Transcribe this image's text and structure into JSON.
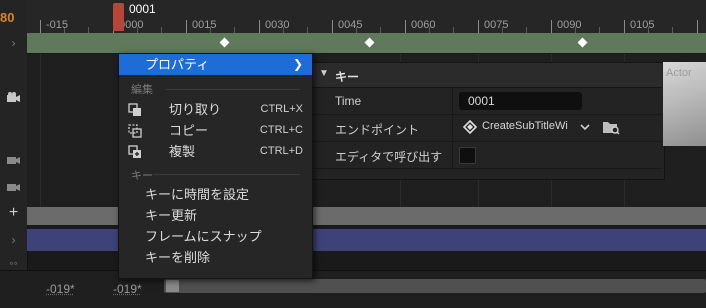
{
  "current_frame": "80",
  "playhead": {
    "label": "0001"
  },
  "ruler": {
    "labels": [
      "-015",
      "0000",
      "0015",
      "0030",
      "0045",
      "0060",
      "0075",
      "0090",
      "0105"
    ]
  },
  "bottom": {
    "start_label": "-019*",
    "end_label": "-019*"
  },
  "context_menu": {
    "properties_label": "プロパティ",
    "section_edit": "編集",
    "cut_label": "切り取り",
    "cut_shortcut": "CTRL+X",
    "copy_label": "コピー",
    "copy_shortcut": "CTRL+C",
    "duplicate_label": "複製",
    "duplicate_shortcut": "CTRL+D",
    "section_key": "キー",
    "set_key_time_label": "キーに時間を設定",
    "rekey_label": "キー更新",
    "snap_to_frame_label": "フレームにスナップ",
    "delete_key_label": "キーを削除"
  },
  "property_panel": {
    "header": "キー",
    "rows": {
      "time": {
        "name": "Time",
        "value": "0001"
      },
      "endpoint": {
        "name": "エンドポイント",
        "value": "CreateSubTitleWi"
      },
      "call_in_editor": {
        "name": "エディタで呼び出す"
      }
    }
  },
  "preview": {
    "label": "Actor"
  },
  "colors": {
    "highlight": "#1d6cd8",
    "playhead": "#b7463a",
    "track_green": "#5f7a5a",
    "track_purple": "#3d4378",
    "frame_number": "#d5852b"
  }
}
